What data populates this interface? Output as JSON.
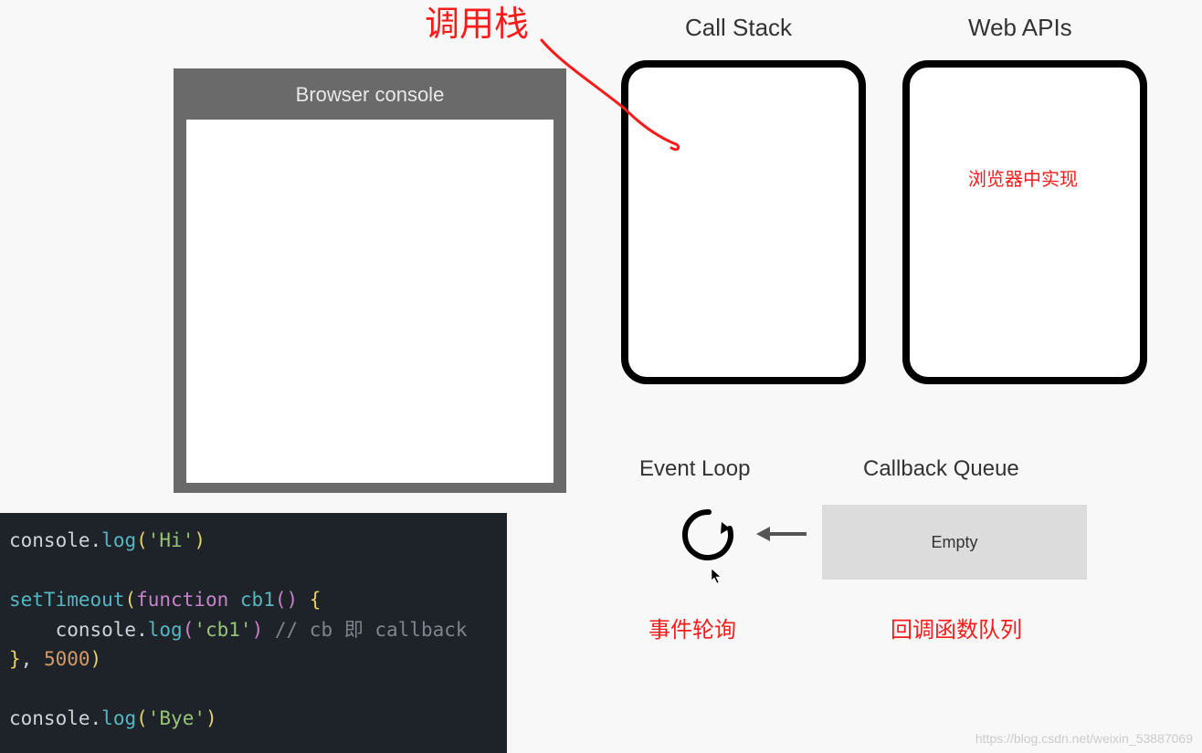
{
  "titles": {
    "browser_console": "Browser console",
    "call_stack": "Call Stack",
    "web_apis": "Web APIs",
    "event_loop": "Event Loop",
    "callback_queue": "Callback Queue"
  },
  "annotations": {
    "call_stack_cn": "调用栈",
    "browser_impl_cn": "浏览器中实现",
    "event_loop_cn": "事件轮询",
    "callback_queue_cn": "回调函数队列"
  },
  "callback_queue": {
    "status": "Empty"
  },
  "code": {
    "line1": {
      "obj": "console",
      "method": "log",
      "arg": "'Hi'"
    },
    "line3": {
      "fn": "setTimeout",
      "kw": "function",
      "cbname": "cb1",
      "open": "() {"
    },
    "line4": {
      "obj": "console",
      "method": "log",
      "arg": "'cb1'",
      "comment": "// cb 即 callback"
    },
    "line5": {
      "close": "}",
      "delay": "5000"
    },
    "line7": {
      "obj": "console",
      "method": "log",
      "arg": "'Bye'"
    }
  },
  "watermark": "https://blog.csdn.net/weixin_53887069",
  "colors": {
    "annotation": "#ff1a1a",
    "console_frame": "#6a6a6a",
    "queue_bg": "#dcdcdc",
    "code_bg": "#1e2329"
  }
}
